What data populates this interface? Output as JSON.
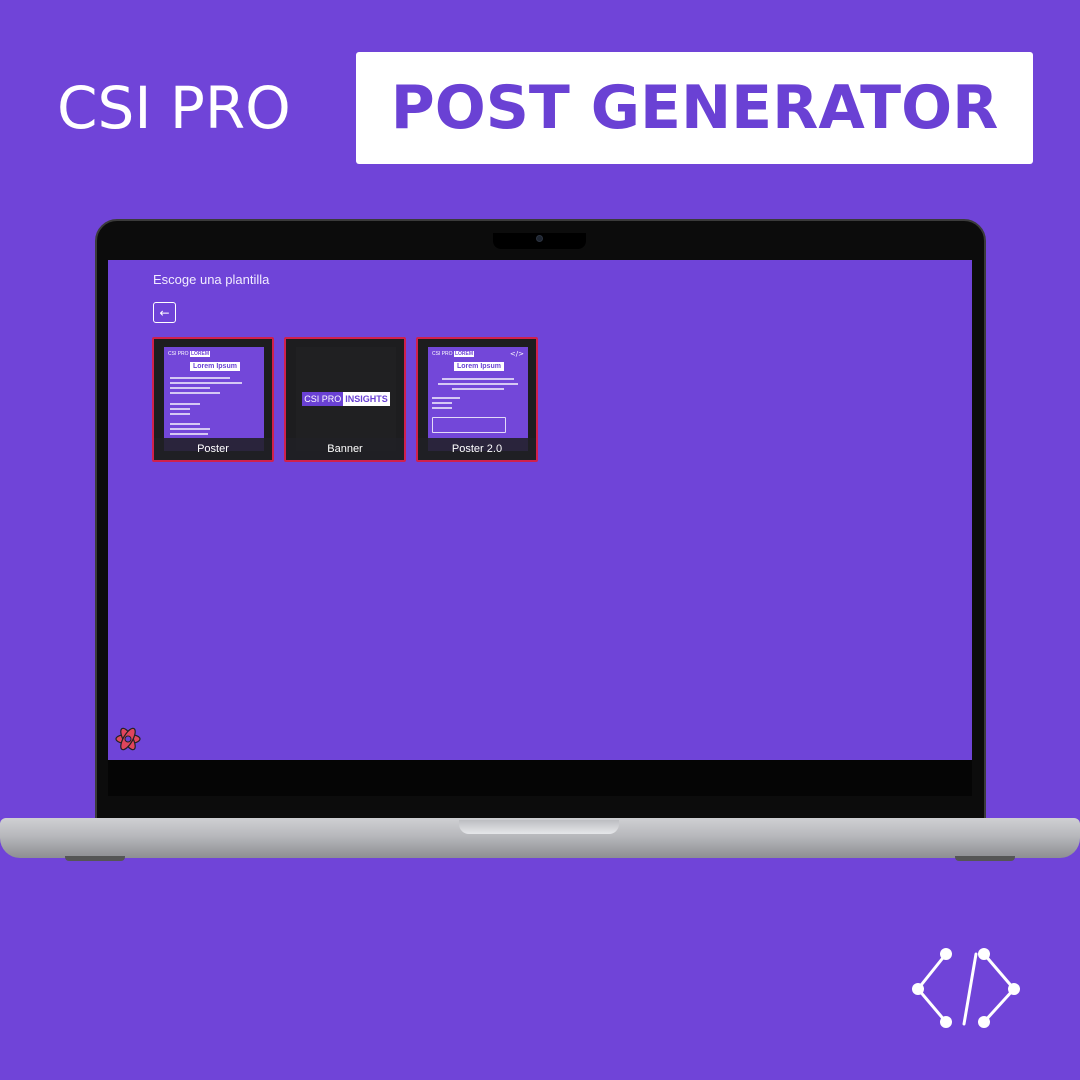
{
  "header": {
    "brand": "CSI PRO",
    "title": "POST GENERATOR"
  },
  "app": {
    "title": "Escoge una plantilla",
    "back_button": "←",
    "templates": [
      {
        "label": "Poster"
      },
      {
        "label": "Banner"
      },
      {
        "label": "Poster 2.0"
      }
    ],
    "thumb_poster": {
      "brand": "CSI PRO",
      "brand_highlight": "LOREM",
      "title": "Lorem Ipsum"
    },
    "thumb_banner": {
      "brand": "CSI PRO",
      "brand_highlight": "INSIGHTS"
    },
    "thumb_poster2": {
      "brand": "CSI PRO",
      "brand_highlight": "LOREM",
      "title": "Lorem Ipsum",
      "bullets": [
        "• Lorem ipsum dolor sit amet",
        "• Vestibulum ante ipsum primis",
        "• Sed euismod quam"
      ]
    }
  },
  "colors": {
    "background": "#7044d8",
    "accent": "#6a41d4",
    "card_border": "#d0214c"
  },
  "icons": {
    "back": "arrow-left-icon",
    "react": "react-logo-icon",
    "corner": "code-brackets-icon"
  }
}
